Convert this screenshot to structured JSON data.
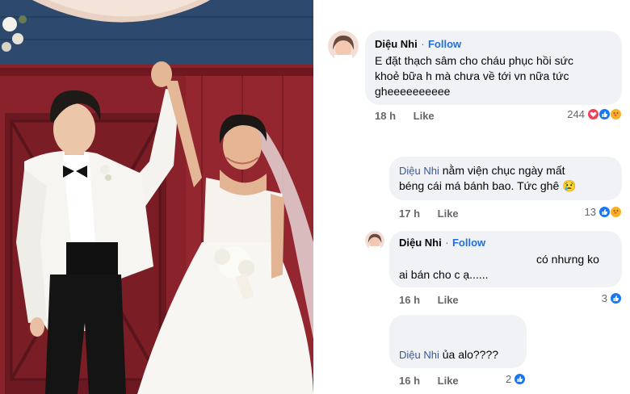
{
  "comments": [
    {
      "name": "Diệu Nhi",
      "follow": "Follow",
      "text_lines": [
        "E đặt thạch sâm cho cháu phục hồi sức",
        "khoẻ bữa h mà chưa về tới vn nữa tức",
        "gheeeeeeeeee"
      ],
      "time": "18 h",
      "like": "Like",
      "reaction_count": "244",
      "reactions": [
        "love-icon",
        "like-icon",
        "care-icon"
      ]
    },
    {
      "mention": "Diệu Nhi",
      "text_lines": [
        "nằm viện chục ngày mất",
        "béng cái má bánh bao. Tức ghê 😢"
      ],
      "time": "17 h",
      "like": "Like",
      "reaction_count": "13",
      "reactions": [
        "like-icon",
        "care-icon"
      ]
    },
    {
      "name": "Diệu Nhi",
      "follow": "Follow",
      "text_lines": [
        "có nhưng ko",
        "ai bán cho c ạ......"
      ],
      "time": "16 h",
      "like": "Like",
      "reaction_count": "3",
      "reactions": [
        "like-icon"
      ]
    },
    {
      "mention": "Diệu Nhi",
      "text_lines": [
        "ủa alo????"
      ],
      "time": "16 h",
      "like": "Like",
      "reaction_count": "2",
      "reactions": [
        "like-icon"
      ]
    }
  ],
  "colors": {
    "bubble": "#f0f2f5",
    "follow": "#216fdb",
    "mention": "#385898",
    "like_reaction": "#1877f2",
    "love_reaction": "#f33e58",
    "care_reaction": "#f7b125"
  }
}
